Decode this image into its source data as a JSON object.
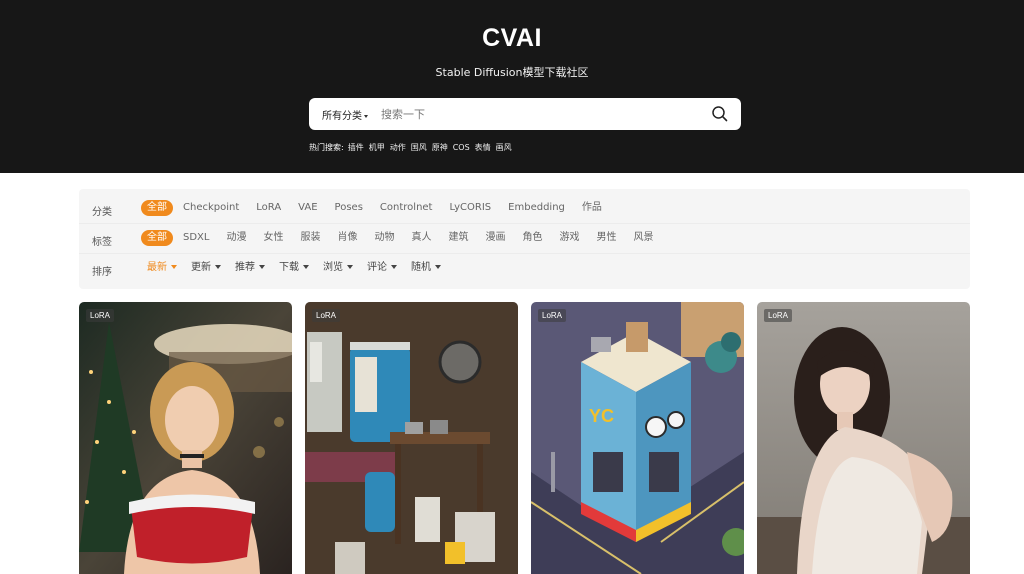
{
  "header": {
    "title": "CVAI",
    "subtitle": "Stable Diffusion模型下载社区"
  },
  "search": {
    "scope_label": "所有分类",
    "placeholder": "搜索一下",
    "icon": "search-icon"
  },
  "hot_search": {
    "label": "热门搜索:",
    "tags": [
      "插件",
      "机甲",
      "动作",
      "国风",
      "原神",
      "COS",
      "表情",
      "画风"
    ]
  },
  "filters": {
    "category": {
      "label": "分类",
      "items": [
        "全部",
        "Checkpoint",
        "LoRA",
        "VAE",
        "Poses",
        "Controlnet",
        "LyCORIS",
        "Embedding",
        "作品"
      ],
      "active": "全部"
    },
    "tags": {
      "label": "标签",
      "items": [
        "全部",
        "SDXL",
        "动漫",
        "女性",
        "服装",
        "肖像",
        "动物",
        "真人",
        "建筑",
        "漫画",
        "角色",
        "游戏",
        "男性",
        "风景"
      ],
      "active": "全部"
    },
    "sort": {
      "label": "排序",
      "items": [
        "最新",
        "更新",
        "推荐",
        "下载",
        "浏览",
        "评论",
        "随机"
      ],
      "active": "最新"
    }
  },
  "cards": [
    {
      "badge": "LoRA"
    },
    {
      "badge": "LoRA"
    },
    {
      "badge": "LoRA"
    },
    {
      "badge": "LoRA"
    }
  ],
  "colors": {
    "accent": "#f08a1d",
    "hero_bg": "#171717",
    "panel_bg": "#f5f5f5"
  }
}
